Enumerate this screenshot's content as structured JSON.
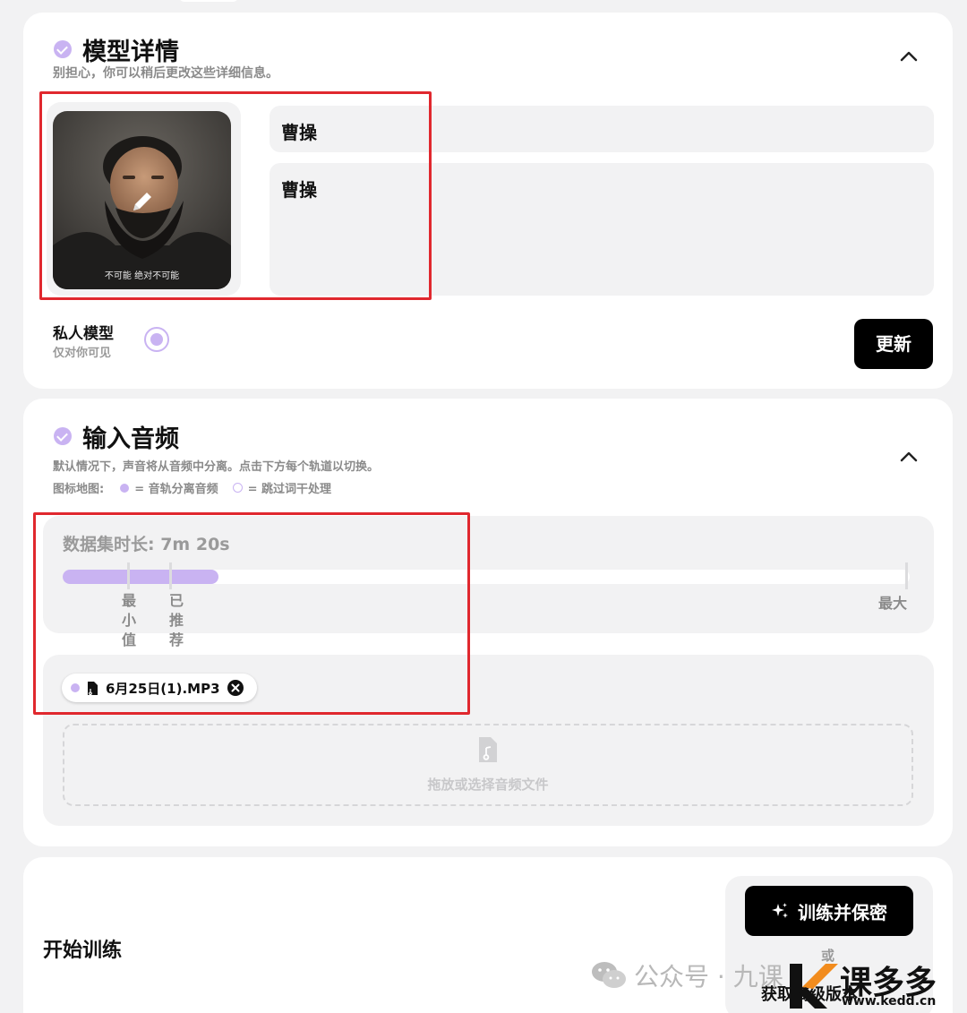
{
  "model_details": {
    "title": "模型详情",
    "subtitle": "别担心，你可以稍后更改这些详细信息。",
    "avatar_caption": "不可能 绝对不可能",
    "name_value": "曹操",
    "description_value": "曹操",
    "private_title": "私人模型",
    "private_sub": "仅对你可见",
    "update_button": "更新"
  },
  "input_audio": {
    "title": "输入音频",
    "subtitle": "默认情况下，声音将从音频中分离。点击下方每个轨道以切换。",
    "legend_prefix": "图标地图:",
    "legend_filled": "= 音轨分离音频",
    "legend_empty": "= 跳过词干处理",
    "duration": "数据集时长: 7m 20s",
    "progress_fraction": 0.184,
    "min_label": [
      "最",
      "小",
      "值"
    ],
    "recommended_label": [
      "已",
      "推",
      "荐"
    ],
    "max_label": "最大",
    "file_name": "6月25日(1).MP3",
    "drop_text": "拖放或选择音频文件"
  },
  "training": {
    "title": "开始训练",
    "train_button": "训练并保密",
    "or_text": "或",
    "other_text": "获取高级版本"
  },
  "watermark": {
    "text": "公众号 · 九课",
    "logo_text": "课多多",
    "logo_url": "www.kedd.cn"
  },
  "colors": {
    "accent": "#c9b3f2",
    "highlight_box": "#e0282e",
    "button": "#000000",
    "logo_orange": "#f28c1e"
  },
  "icons": [
    "check-icon",
    "chevron-up-icon",
    "pencil-icon",
    "file-icon",
    "close-circle-icon",
    "audio-file-icon",
    "sparkle-icon",
    "wechat-icon"
  ]
}
